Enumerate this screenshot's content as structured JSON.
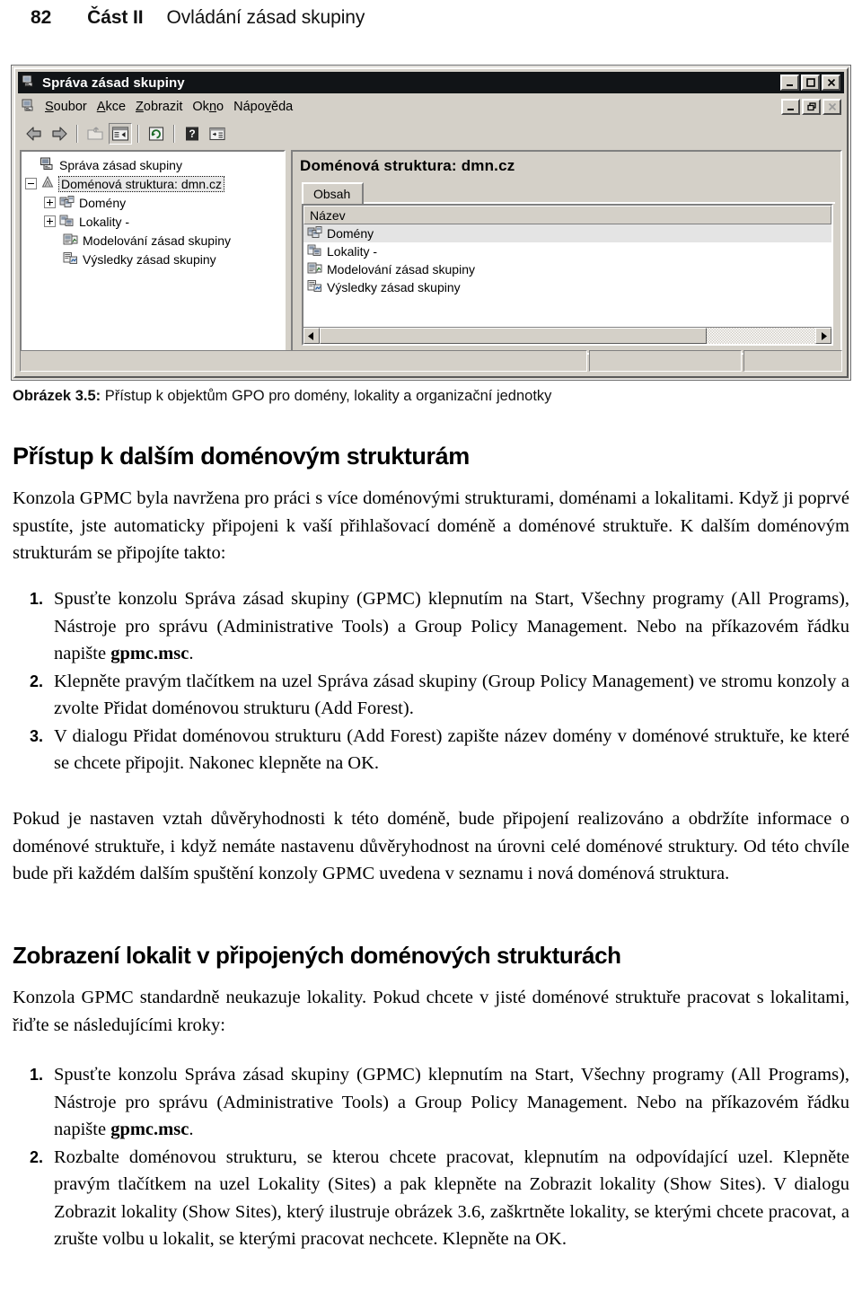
{
  "running_head": {
    "page_number": "82",
    "part": "Část II",
    "chapter": "Ovládání zásad skupiny"
  },
  "screenshot": {
    "window_title": "Správa zásad skupiny",
    "window_buttons": {
      "minimize": "_",
      "maximize": "□",
      "close": "✕"
    },
    "mdi_buttons": {
      "minimize": "_",
      "restore": "❐",
      "close": "✕"
    },
    "menu": [
      {
        "label": "Soubor",
        "accel": "S"
      },
      {
        "label": "Akce",
        "accel": "A"
      },
      {
        "label": "Zobrazit",
        "accel": "Z"
      },
      {
        "label": "Okno",
        "accel": "n"
      },
      {
        "label": "Nápověda",
        "accel": "v"
      }
    ],
    "toolbar": [
      {
        "name": "back-icon",
        "enabled": true
      },
      {
        "name": "forward-icon",
        "enabled": true
      },
      {
        "name": "up-one-level-icon",
        "enabled": false
      },
      {
        "name": "show-hide-console-tree-icon",
        "enabled": true,
        "pressed": true
      },
      {
        "name": "refresh-icon",
        "enabled": true
      },
      {
        "name": "help-icon",
        "enabled": true
      },
      {
        "name": "export-list-icon",
        "enabled": true
      }
    ],
    "tree": [
      {
        "label": "Správa zásad skupiny",
        "icon": "console-root-icon",
        "indent": 0,
        "expander": "none",
        "selected": false
      },
      {
        "label": "Doménová struktura: dmn.cz",
        "icon": "forest-icon",
        "indent": 1,
        "expander": "minus",
        "selected": true
      },
      {
        "label": "Domény",
        "icon": "domains-icon",
        "indent": 2,
        "expander": "plus",
        "selected": false
      },
      {
        "label": "Lokality -",
        "icon": "sites-icon",
        "indent": 2,
        "expander": "plus",
        "selected": false
      },
      {
        "label": "Modelování zásad skupiny",
        "icon": "gp-modeling-icon",
        "indent": 2,
        "expander": "none",
        "selected": false
      },
      {
        "label": "Výsledky zásad skupiny",
        "icon": "gp-results-icon",
        "indent": 2,
        "expander": "none",
        "selected": false
      }
    ],
    "detail": {
      "title": "Doménová struktura: dmn.cz",
      "tabs": [
        {
          "label": "Obsah",
          "active": true
        }
      ],
      "column_header": "Název",
      "rows": [
        {
          "label": "Domény",
          "icon": "domains-icon",
          "highlighted": true
        },
        {
          "label": "Lokality -",
          "icon": "sites-icon",
          "highlighted": false
        },
        {
          "label": "Modelování zásad skupiny",
          "icon": "gp-modeling-icon",
          "highlighted": false
        },
        {
          "label": "Výsledky zásad skupiny",
          "icon": "gp-results-icon",
          "highlighted": false
        }
      ],
      "scrollbar": {
        "left_arrow": "◀",
        "right_arrow": "▶"
      }
    },
    "statusbar": [
      "",
      "",
      ""
    ]
  },
  "caption": {
    "label": "Obrázek 3.5:",
    "text": " Přístup k objektům GPO pro domény, lokality a organizační jednotky"
  },
  "headings": {
    "h1_forests": "Přístup k dalším doménovým strukturám",
    "h1_sites": "Zobrazení lokalit v připojených doménových strukturách"
  },
  "paragraphs": {
    "intro": "Konzola GPMC byla navržena pro práci s více doménovými strukturami, doménami a lokalitami. Když ji poprvé spustíte, jste automaticky připojeni k vaší přihlašovací doméně a doménové struktuře. K dalším doménovým strukturám se připojíte takto:",
    "trust": "Pokud je nastaven vztah důvěryhodnosti k této doméně, bude připojení realizováno a obdržíte informace o doménové struktuře, i když nemáte nastavenu důvěryhodnost na úrovni celé doménové struktury. Od této chvíle bude při každém dalším spuštění konzoly GPMC uvedena v seznamu i nová doménová struktura.",
    "sites_intro": "Konzola GPMC standardně neukazuje lokality. Pokud chcete v jisté doménové struktuře pracovat s lokalitami, řiďte se následujícími kroky:"
  },
  "list_forests": [
    {
      "num": "1.",
      "text_before": "Spusťte konzolu Správa zásad skupiny (GPMC) klepnutím na Start, Všechny programy (All Programs), Nástroje pro správu (Administrative Tools) a Group Policy Management. Nebo na příkazovém řádku napište ",
      "bold": "gpmc.msc",
      "text_after": "."
    },
    {
      "num": "2.",
      "text_before": "Klepněte pravým tlačítkem na uzel Správa zásad skupiny (Group Policy Management) ve stromu konzoly a zvolte Přidat doménovou strukturu (Add Forest).",
      "bold": "",
      "text_after": ""
    },
    {
      "num": "3.",
      "text_before": "V dialogu Přidat doménovou strukturu (Add Forest) zapište název domény v doménové struktuře, ke které se chcete připojit. Nakonec klepněte na OK.",
      "bold": "",
      "text_after": ""
    }
  ],
  "list_sites": [
    {
      "num": "1.",
      "text_before": "Spusťte konzolu Správa zásad skupiny (GPMC) klepnutím na Start, Všechny programy (All Programs), Nástroje pro správu (Administrative Tools) a Group Policy Management. Nebo na příkazovém řádku napište ",
      "bold": "gpmc.msc",
      "text_after": "."
    },
    {
      "num": "2.",
      "text_before": "Rozbalte doménovou strukturu, se kterou chcete pracovat, klepnutím na odpovídající uzel. Klepněte pravým tlačítkem na uzel Lokality (Sites) a pak klepněte na Zobrazit lokality (Show Sites). V dialogu Zobrazit lokality (Show Sites), který ilustruje obrázek 3.6, zaškrtněte lokality, se kterými chcete pracovat, a zrušte volbu u lokalit, se kterými pracovat nechcete. Klepněte na OK.",
      "bold": "",
      "text_after": ""
    }
  ]
}
